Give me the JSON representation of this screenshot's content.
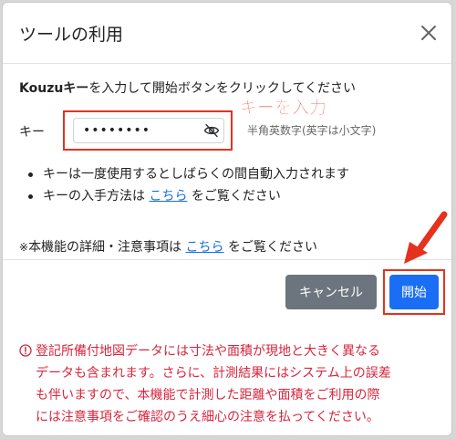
{
  "dialog": {
    "title": "ツールの利用"
  },
  "instruction": {
    "brand": "Kouzuキー",
    "rest": "を入力して開始ボタンをクリックしてください"
  },
  "key_field": {
    "label": "キー",
    "value": "••••••••",
    "hint": "半角英数字(英字は小文字)"
  },
  "annotation": {
    "callout": "キーを入力"
  },
  "bullets": {
    "item1": "キーは一度使用するとしばらくの間自動入力されます",
    "item2_prefix": "キーの入手方法は ",
    "item2_link": "こちら",
    "item2_suffix": " をご覧ください"
  },
  "detail_note": {
    "mark": "※",
    "prefix": "本機能の詳細・注意事項は ",
    "link": "こちら",
    "suffix": " をご覧ください"
  },
  "buttons": {
    "cancel": "キャンセル",
    "start": "開始"
  },
  "warning": {
    "line1": "登記所備付地図データには寸法や面積が現地と大きく異なる",
    "line2": "データも含まれます。さらに、計測結果にはシステム上の誤差",
    "line3": "も伴いますので、本機能で計測した距離や面積をご利用の際",
    "line4": "には注意事項をご確認のうえ細心の注意を払ってください。"
  },
  "colors": {
    "annotation_red": "#e5321f",
    "primary_blue": "#1a6ef5",
    "secondary_gray": "#6c757d",
    "warning_red": "#d7263d",
    "link_blue": "#1a6ee0"
  },
  "icons": {
    "close": "close-icon",
    "eye": "eye-slash-icon",
    "warning": "exclamation-circle-icon",
    "arrow": "annotation-arrow-icon"
  }
}
